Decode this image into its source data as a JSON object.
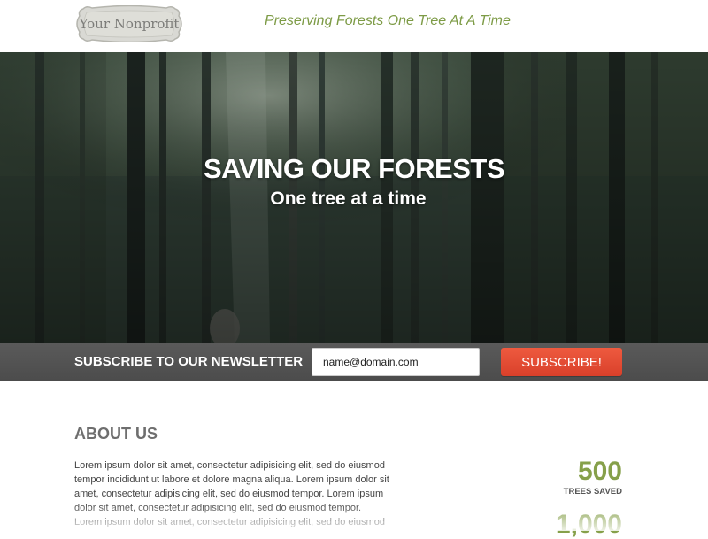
{
  "header": {
    "logo_text": "Your Nonprofit",
    "tagline": "Preserving Forests One Tree At A Time"
  },
  "hero": {
    "title": "SAVING OUR FORESTS",
    "subtitle": "One tree at a time"
  },
  "newsletter": {
    "label": "SUBSCRIBE TO OUR NEWSLETTER",
    "email_value": "name@domain.com",
    "button_label": "SUBSCRIBE!"
  },
  "about": {
    "title": "ABOUT US",
    "body": "Lorem ipsum dolor sit amet, consectetur adipisicing elit, sed do eiusmod tempor incididunt ut labore et dolore magna aliqua. Lorem ipsum dolor sit amet, consectetur adipisicing elit, sed do eiusmod tempor. Lorem ipsum dolor sit amet, consectetur adipisicing elit, sed do eiusmod tempor. Lorem ipsum dolor sit amet, consectetur adipisicing elit, sed do eiusmod"
  },
  "stats": [
    {
      "value": "500",
      "label": "TREES SAVED"
    },
    {
      "value": "1,000",
      "label": ""
    }
  ],
  "colors": {
    "accent_green": "#86a04a",
    "tagline_green": "#7d9b46",
    "subscribe_red": "#e4492f",
    "newsletter_bar": "#535353"
  }
}
